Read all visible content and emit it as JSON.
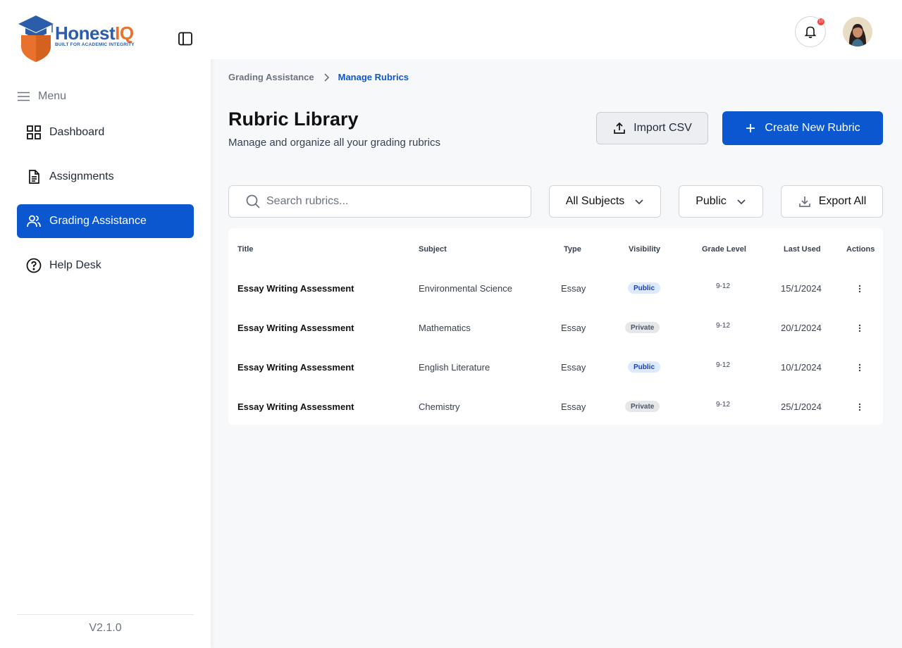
{
  "brand": {
    "name": "Honest",
    "name_suffix": "IQ",
    "tagline": "BUILT FOR ACADEMIC INTEGRITY",
    "primary_color": "#2b5dab",
    "accent_color": "#e8722c"
  },
  "sidebar": {
    "menu_label": "Menu",
    "items": [
      {
        "label": "Dashboard",
        "icon": "grid-icon",
        "active": false
      },
      {
        "label": "Assignments",
        "icon": "document-icon",
        "active": false
      },
      {
        "label": "Grading Assistance",
        "icon": "users-icon",
        "active": true
      },
      {
        "label": "Help Desk",
        "icon": "help-circle-icon",
        "active": false
      }
    ],
    "version": "V2.1.0"
  },
  "topbar": {
    "notification_count": "10"
  },
  "breadcrumb": {
    "parent": "Grading Assistance",
    "current": "Manage Rubrics"
  },
  "header": {
    "title": "Rubric Library",
    "subtitle": "Manage and organize all your grading rubrics",
    "import_label": "Import CSV",
    "create_label": "Create New Rubric"
  },
  "filters": {
    "search_placeholder": "Search rubrics...",
    "subject_selected": "All Subjects",
    "visibility_selected": "Public",
    "export_label": "Export All"
  },
  "table": {
    "columns": [
      "Title",
      "Subject",
      "Type",
      "Visibility",
      "Grade Level",
      "Last Used",
      "Actions"
    ],
    "rows": [
      {
        "title": "Essay Writing Assessment",
        "subject": "Environmental Science",
        "type": "Essay",
        "visibility": "Public",
        "grade": "9-12",
        "last_used": "15/1/2024"
      },
      {
        "title": "Essay Writing Assessment",
        "subject": "Mathematics",
        "type": "Essay",
        "visibility": "Private",
        "grade": "9-12",
        "last_used": "20/1/2024"
      },
      {
        "title": "Essay Writing Assessment",
        "subject": "English Literature",
        "type": "Essay",
        "visibility": "Public",
        "grade": "9-12",
        "last_used": "10/1/2024"
      },
      {
        "title": "Essay Writing Assessment",
        "subject": "Chemistry",
        "type": "Essay",
        "visibility": "Private",
        "grade": "9-12",
        "last_used": "25/1/2024"
      }
    ]
  },
  "colors": {
    "primary": "#0b57d0",
    "public_badge_bg": "#dbeafe",
    "private_badge_bg": "#e5e7eb"
  }
}
